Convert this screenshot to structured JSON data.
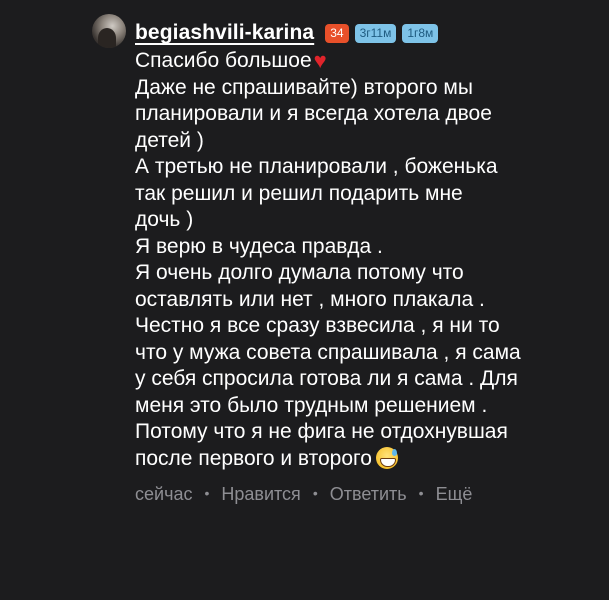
{
  "comment": {
    "author": "begiashvili-karina",
    "level_badge": "34",
    "badges": [
      "3г11м",
      "1г8м"
    ],
    "lines": [
      "Спасибо большое",
      "Даже не спрашивайте) второго мы",
      "планировали и я всегда хотела двое",
      "детей )",
      "А третью не планировали , боженька",
      "так решил и решил подарить мне",
      "дочь )",
      "Я верю в чудеса правда .",
      "Я очень долго думала потому что",
      "оставлять или нет , много плакала .",
      "Честно я все сразу взвесила , я ни то",
      "что у мужа совета спрашивала , я сама",
      "у себя спросила готова ли я сама . Для",
      "меня это было трудным решением .",
      "Потому что я не фига не отдохнувшая",
      "после первого и второго"
    ],
    "emoji": {
      "heart": "heart-emoji",
      "grin": "grinning-sweat-emoji"
    },
    "actions": {
      "time": "сейчас",
      "like": "Нравится",
      "reply": "Ответить",
      "more": "Ещё"
    }
  },
  "colors": {
    "background": "#1c1c1e",
    "text": "#ffffff",
    "muted": "#8e8e93",
    "level_badge": "#e8502a",
    "time_badge": "#7ec3e8"
  }
}
